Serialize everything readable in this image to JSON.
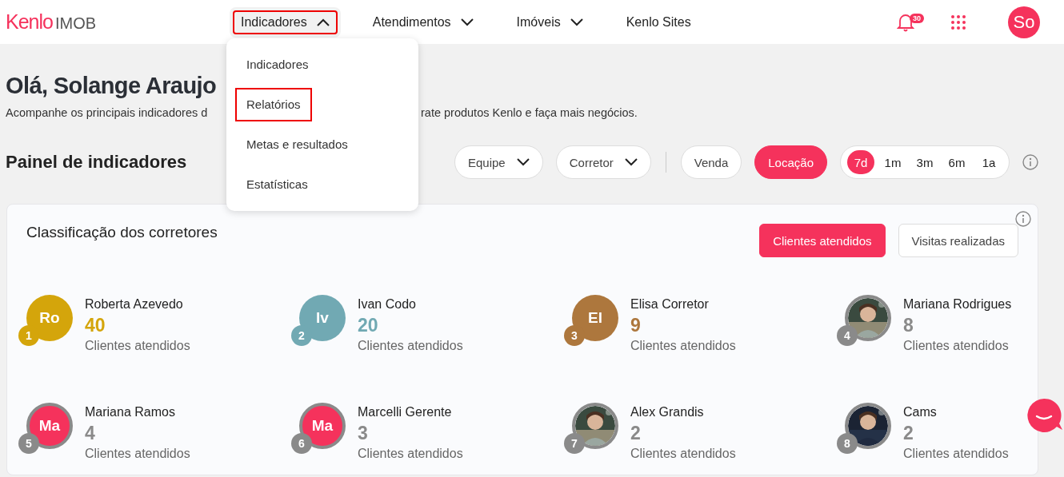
{
  "header": {
    "logo": {
      "brand": "Kenlo",
      "product": "IMOB"
    },
    "nav": [
      {
        "label": "Indicadores",
        "dropdown": true,
        "expanded": true,
        "highlighted": true
      },
      {
        "label": "Atendimentos",
        "dropdown": true,
        "expanded": false,
        "highlighted": false
      },
      {
        "label": "Imóveis",
        "dropdown": true,
        "expanded": false,
        "highlighted": false
      },
      {
        "label": "Kenlo Sites",
        "dropdown": false,
        "expanded": false,
        "highlighted": false
      }
    ],
    "notifications": {
      "count": "30"
    },
    "user": {
      "initials": "So"
    }
  },
  "menu": {
    "items": [
      {
        "label": "Indicadores",
        "highlighted": false
      },
      {
        "label": "Relatórios",
        "highlighted": true
      },
      {
        "label": "Metas e resultados",
        "highlighted": false
      },
      {
        "label": "Estatísticas",
        "highlighted": false
      }
    ]
  },
  "greeting": {
    "title": "Olá, Solange Araujo",
    "subtitle_parts": [
      "Acompanhe os principais indicadores d",
      "rate produtos Kenlo e faça mais negócios."
    ]
  },
  "panel": {
    "title": "Painel de indicadores",
    "dropdowns": [
      {
        "label": "Equipe"
      },
      {
        "label": "Corretor"
      }
    ],
    "modes": [
      {
        "label": "Venda",
        "selected": false
      },
      {
        "label": "Locação",
        "selected": true
      }
    ],
    "periods": [
      {
        "label": "7d",
        "selected": true
      },
      {
        "label": "1m",
        "selected": false
      },
      {
        "label": "3m",
        "selected": false
      },
      {
        "label": "6m",
        "selected": false
      },
      {
        "label": "1a",
        "selected": false
      }
    ]
  },
  "ranking": {
    "title": "Classificação dos corretores",
    "metrics": [
      {
        "label": "Clientes atendidos",
        "selected": true
      },
      {
        "label": "Visitas realizadas",
        "selected": false
      }
    ],
    "brokers": [
      {
        "rank": "1",
        "name": "Roberta Azevedo",
        "count": "40",
        "caption": "Clientes atendidos",
        "kind": "initials",
        "initials": "Ro",
        "color": "#d4a50b"
      },
      {
        "rank": "2",
        "name": "Ivan Codo",
        "count": "20",
        "caption": "Clientes atendidos",
        "kind": "initials",
        "initials": "Iv",
        "color": "#71a9b3"
      },
      {
        "rank": "3",
        "name": "Elisa Corretor",
        "count": "9",
        "caption": "Clientes atendidos",
        "kind": "initials",
        "initials": "El",
        "color": "#ad773d"
      },
      {
        "rank": "4",
        "name": "Mariana Rodrigues",
        "count": "8",
        "caption": "Clientes atendidos",
        "kind": "picture",
        "color": "#8a8a8a"
      },
      {
        "rank": "5",
        "name": "Mariana Ramos",
        "count": "4",
        "caption": "Clientes atendidos",
        "kind": "ringed",
        "initials": "Ma",
        "color": "#8a8a8a"
      },
      {
        "rank": "6",
        "name": "Marcelli Gerente",
        "count": "3",
        "caption": "Clientes atendidos",
        "kind": "ringed",
        "initials": "Ma",
        "color": "#8a8a8a"
      },
      {
        "rank": "7",
        "name": "Alex Grandis",
        "count": "2",
        "caption": "Clientes atendidos",
        "kind": "picture",
        "color": "#8a8a8a"
      },
      {
        "rank": "8",
        "name": "Cams",
        "count": "2",
        "caption": "Clientes atendidos",
        "kind": "picture",
        "color": "#8a8a8a"
      }
    ]
  }
}
